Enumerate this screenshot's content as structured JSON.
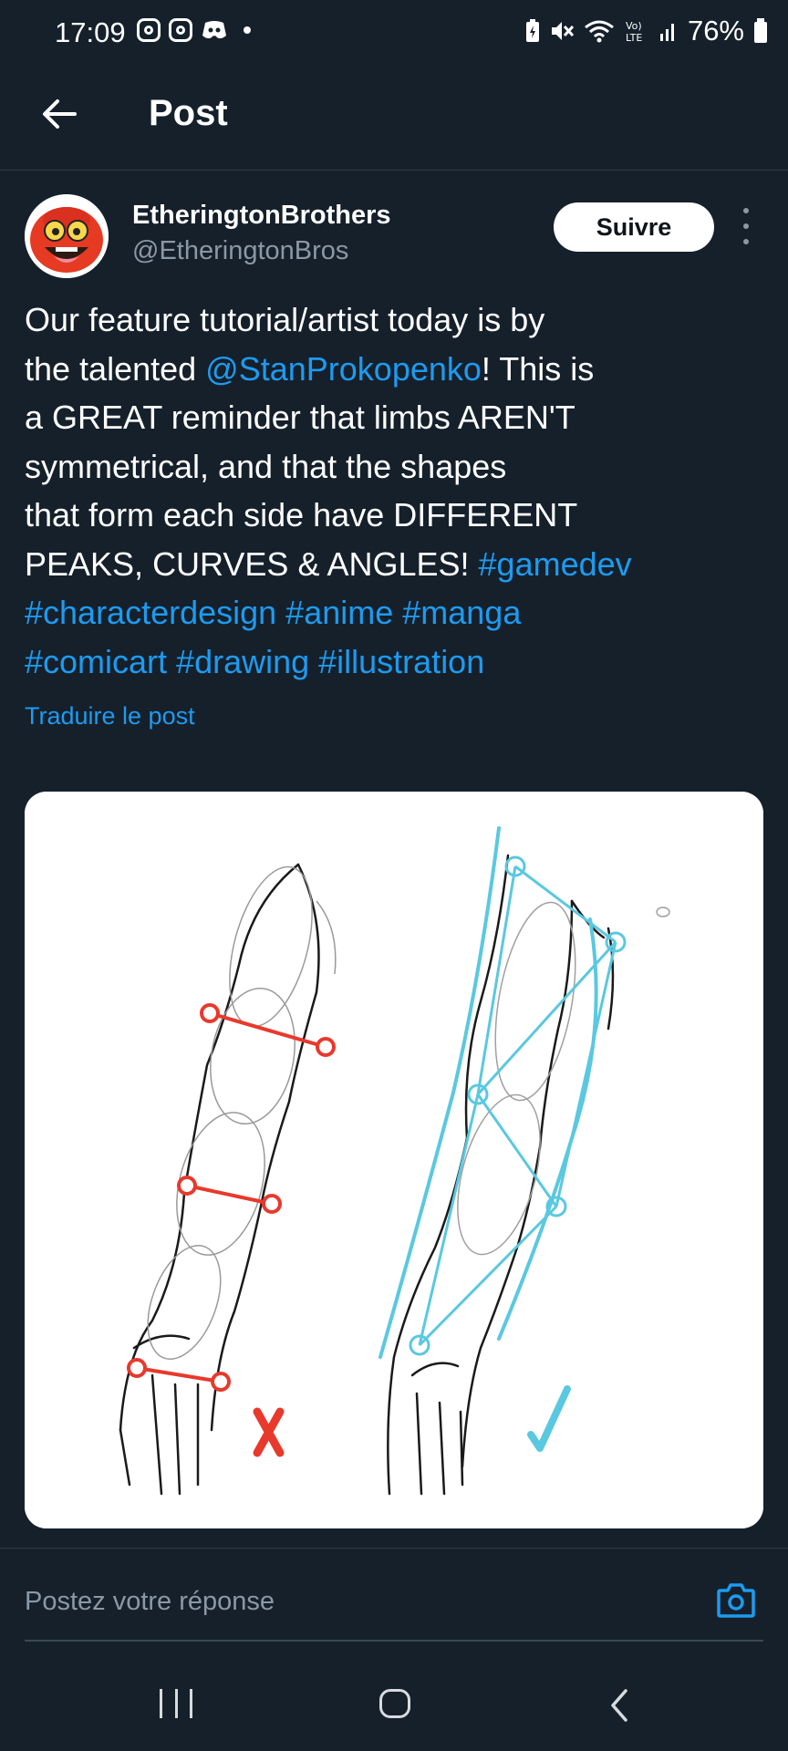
{
  "status_bar": {
    "time": "17:09",
    "battery": "76%",
    "icons": [
      "instagram-icon",
      "instagram-icon",
      "discord-icon",
      "notification-dot",
      "battery-saver-icon",
      "mute-icon",
      "wifi-6-icon",
      "volte-icon",
      "signal-icon",
      "battery-icon"
    ]
  },
  "header": {
    "title": "Post",
    "back_icon": "arrow-left-icon"
  },
  "post": {
    "author_name": "EtheringtonBrothers",
    "author_handle": "@EtheringtonBros",
    "follow_label": "Suivre",
    "text_lines": [
      [
        {
          "t": "Our feature tutorial/artist today is by",
          "link": false
        }
      ],
      [
        {
          "t": "the talented ",
          "link": false
        },
        {
          "t": "@StanProkopenko",
          "link": true
        },
        {
          "t": "! This is",
          "link": false
        }
      ],
      [
        {
          "t": "a GREAT reminder that limbs AREN'T",
          "link": false
        }
      ],
      [
        {
          "t": "symmetrical, and that the shapes",
          "link": false
        }
      ],
      [
        {
          "t": "that form each side have DIFFERENT",
          "link": false
        }
      ],
      [
        {
          "t": "PEAKS, CURVES & ANGLES! ",
          "link": false
        },
        {
          "t": "#gamedev",
          "link": true
        }
      ],
      [
        {
          "t": "#characterdesign #anime #manga",
          "link": true
        }
      ],
      [
        {
          "t": "#comicart #drawing #illustration",
          "link": true
        }
      ]
    ],
    "translate_label": "Traduire le post",
    "media": {
      "wrong_mark": "X",
      "right_mark": "✓",
      "colors": {
        "wrong": "#e8392d",
        "right": "#5ac8e0"
      }
    }
  },
  "reply": {
    "placeholder": "Postez votre réponse",
    "camera_icon": "camera-icon"
  },
  "nav_bar": {
    "icons": [
      "recent-apps-icon",
      "home-icon",
      "back-icon"
    ]
  },
  "colors": {
    "background": "#15202b",
    "accent": "#1d9bf0",
    "muted": "#8b98a5"
  }
}
